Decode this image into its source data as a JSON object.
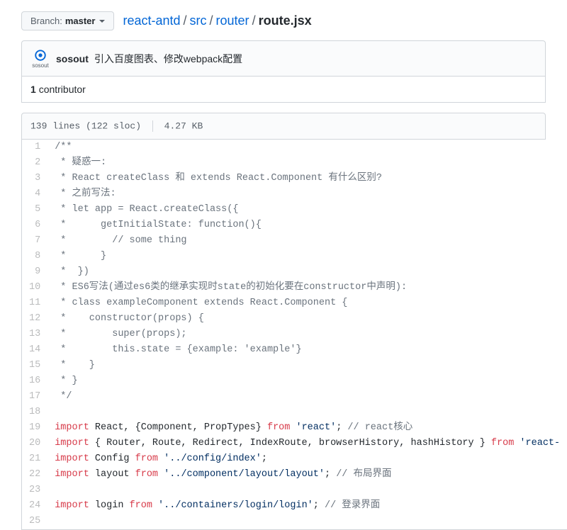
{
  "branch": {
    "label": "Branch:",
    "value": "master"
  },
  "breadcrumb": {
    "repo": "react-antd",
    "parts": [
      "src",
      "router"
    ],
    "current": "route.jsx"
  },
  "commit": {
    "author": "sosout",
    "message": "引入百度图表、修改webpack配置",
    "avatar_label": "sosout"
  },
  "contributors": {
    "count": "1",
    "label": "contributor"
  },
  "file_meta": {
    "lines": "139 lines (122 sloc)",
    "size": "4.27 KB"
  },
  "code": [
    {
      "n": "1",
      "tokens": [
        {
          "t": "/**",
          "c": "c-comment"
        }
      ]
    },
    {
      "n": "2",
      "tokens": [
        {
          "t": " * 疑惑一:",
          "c": "c-comment"
        }
      ]
    },
    {
      "n": "3",
      "tokens": [
        {
          "t": " * React createClass 和 extends React.Component 有什么区别?",
          "c": "c-comment"
        }
      ]
    },
    {
      "n": "4",
      "tokens": [
        {
          "t": " * 之前写法:",
          "c": "c-comment"
        }
      ]
    },
    {
      "n": "5",
      "tokens": [
        {
          "t": " * let app = React.createClass({",
          "c": "c-comment"
        }
      ]
    },
    {
      "n": "6",
      "tokens": [
        {
          "t": " *      getInitialState: function(){",
          "c": "c-comment"
        }
      ]
    },
    {
      "n": "7",
      "tokens": [
        {
          "t": " *        // some thing",
          "c": "c-comment"
        }
      ]
    },
    {
      "n": "8",
      "tokens": [
        {
          "t": " *      }",
          "c": "c-comment"
        }
      ]
    },
    {
      "n": "9",
      "tokens": [
        {
          "t": " *  })",
          "c": "c-comment"
        }
      ]
    },
    {
      "n": "10",
      "tokens": [
        {
          "t": " * ES6写法(通过es6类的继承实现时state的初始化要在constructor中声明):",
          "c": "c-comment"
        }
      ]
    },
    {
      "n": "11",
      "tokens": [
        {
          "t": " * class exampleComponent extends React.Component {",
          "c": "c-comment"
        }
      ]
    },
    {
      "n": "12",
      "tokens": [
        {
          "t": " *    constructor(props) {",
          "c": "c-comment"
        }
      ]
    },
    {
      "n": "13",
      "tokens": [
        {
          "t": " *        super(props);",
          "c": "c-comment"
        }
      ]
    },
    {
      "n": "14",
      "tokens": [
        {
          "t": " *        this.state = {example: 'example'}",
          "c": "c-comment"
        }
      ]
    },
    {
      "n": "15",
      "tokens": [
        {
          "t": " *    }",
          "c": "c-comment"
        }
      ]
    },
    {
      "n": "16",
      "tokens": [
        {
          "t": " * }",
          "c": "c-comment"
        }
      ]
    },
    {
      "n": "17",
      "tokens": [
        {
          "t": " */",
          "c": "c-comment"
        }
      ]
    },
    {
      "n": "18",
      "tokens": []
    },
    {
      "n": "19",
      "tokens": [
        {
          "t": "import",
          "c": "c-keyword"
        },
        {
          "t": " React, {Component, PropTypes} ",
          "c": ""
        },
        {
          "t": "from",
          "c": "c-keyword"
        },
        {
          "t": " ",
          "c": ""
        },
        {
          "t": "'react'",
          "c": "c-string"
        },
        {
          "t": "; ",
          "c": ""
        },
        {
          "t": "// react核心",
          "c": "c-comment"
        }
      ]
    },
    {
      "n": "20",
      "tokens": [
        {
          "t": "import",
          "c": "c-keyword"
        },
        {
          "t": " { Router, Route, Redirect, IndexRoute, browserHistory, hashHistory } ",
          "c": ""
        },
        {
          "t": "from",
          "c": "c-keyword"
        },
        {
          "t": " ",
          "c": ""
        },
        {
          "t": "'react-",
          "c": "c-string"
        }
      ]
    },
    {
      "n": "21",
      "tokens": [
        {
          "t": "import",
          "c": "c-keyword"
        },
        {
          "t": " Config ",
          "c": ""
        },
        {
          "t": "from",
          "c": "c-keyword"
        },
        {
          "t": " ",
          "c": ""
        },
        {
          "t": "'../config/index'",
          "c": "c-string"
        },
        {
          "t": ";",
          "c": ""
        }
      ]
    },
    {
      "n": "22",
      "tokens": [
        {
          "t": "import",
          "c": "c-keyword"
        },
        {
          "t": " layout ",
          "c": ""
        },
        {
          "t": "from",
          "c": "c-keyword"
        },
        {
          "t": " ",
          "c": ""
        },
        {
          "t": "'../component/layout/layout'",
          "c": "c-string"
        },
        {
          "t": "; ",
          "c": ""
        },
        {
          "t": "// 布局界面",
          "c": "c-comment"
        }
      ]
    },
    {
      "n": "23",
      "tokens": []
    },
    {
      "n": "24",
      "tokens": [
        {
          "t": "import",
          "c": "c-keyword"
        },
        {
          "t": " login ",
          "c": ""
        },
        {
          "t": "from",
          "c": "c-keyword"
        },
        {
          "t": " ",
          "c": ""
        },
        {
          "t": "'../containers/login/login'",
          "c": "c-string"
        },
        {
          "t": "; ",
          "c": ""
        },
        {
          "t": "// 登录界面",
          "c": "c-comment"
        }
      ]
    },
    {
      "n": "25",
      "tokens": []
    }
  ]
}
